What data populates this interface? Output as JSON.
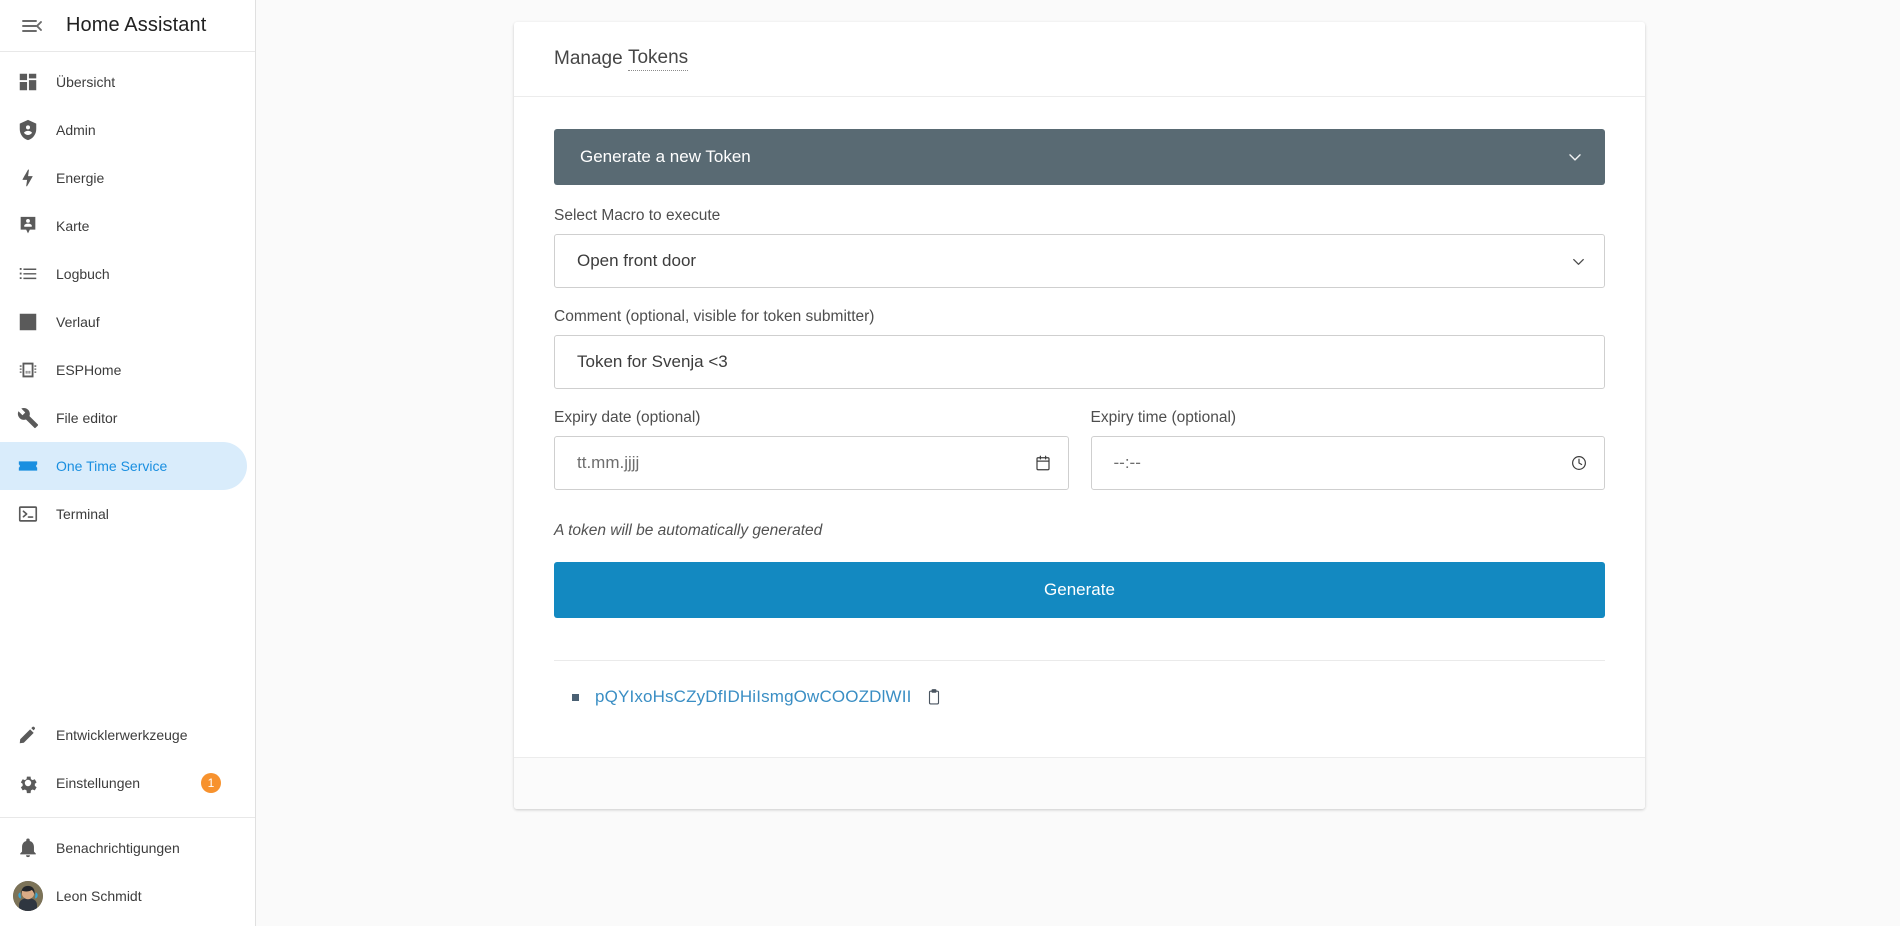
{
  "app": {
    "title": "Home Assistant",
    "menu_icon": "menu-collapse-icon"
  },
  "sidebar": {
    "items": [
      {
        "label": "Übersicht",
        "icon": "view-dashboard-icon",
        "active": false
      },
      {
        "label": "Admin",
        "icon": "shield-account-icon",
        "active": false
      },
      {
        "label": "Energie",
        "icon": "lightning-bolt-icon",
        "active": false
      },
      {
        "label": "Karte",
        "icon": "map-marker-account-icon",
        "active": false
      },
      {
        "label": "Logbuch",
        "icon": "format-list-bulleted-icon",
        "active": false
      },
      {
        "label": "Verlauf",
        "icon": "chart-box-icon",
        "active": false
      },
      {
        "label": "ESPHome",
        "icon": "chip-icon",
        "active": false
      },
      {
        "label": "File editor",
        "icon": "wrench-icon",
        "active": false
      },
      {
        "label": "One Time Service",
        "icon": "ticket-icon",
        "active": true
      },
      {
        "label": "Terminal",
        "icon": "console-icon",
        "active": false
      }
    ],
    "bottom_items": [
      {
        "label": "Entwicklerwerkzeuge",
        "icon": "hammer-wrench-icon",
        "badge": ""
      },
      {
        "label": "Einstellungen",
        "icon": "cog-icon",
        "badge": "1"
      }
    ],
    "footer_items": [
      {
        "label": "Benachrichtigungen",
        "icon": "bell-icon"
      },
      {
        "label": "Leon Schmidt",
        "icon": "user-avatar"
      }
    ],
    "active_color": "#1a8fe0",
    "active_bg": "#d9ecfb",
    "badge_color": "#f7922e"
  },
  "card": {
    "header": {
      "prefix": "Manage",
      "linked": "Tokens"
    },
    "accordion": {
      "title": "Generate a new Token",
      "chevron_icon": "chevron-down-icon",
      "bg_color": "#596a73"
    },
    "form": {
      "macro": {
        "label": "Select Macro to execute",
        "value": "Open front door",
        "options": [
          "Open front door"
        ],
        "chevron_icon": "chevron-down-icon"
      },
      "comment": {
        "label": "Comment (optional, visible for token submitter)",
        "value": "Token for Svenja <3",
        "placeholder": ""
      },
      "expiry_date": {
        "label": "Expiry date (optional)",
        "value": "",
        "placeholder": "tt.mm.jjjj",
        "icon": "calendar-icon"
      },
      "expiry_time": {
        "label": "Expiry time (optional)",
        "value": "",
        "placeholder": "--:--",
        "icon": "clock-icon"
      },
      "hint": "A token will be automatically generated",
      "submit_label": "Generate",
      "submit_color": "#1389c1"
    },
    "tokens": [
      {
        "value": "pQYIxoHsCZyDfIDHiIsmgOwCOOZDlWII",
        "copy_icon": "clipboard-icon"
      }
    ]
  }
}
